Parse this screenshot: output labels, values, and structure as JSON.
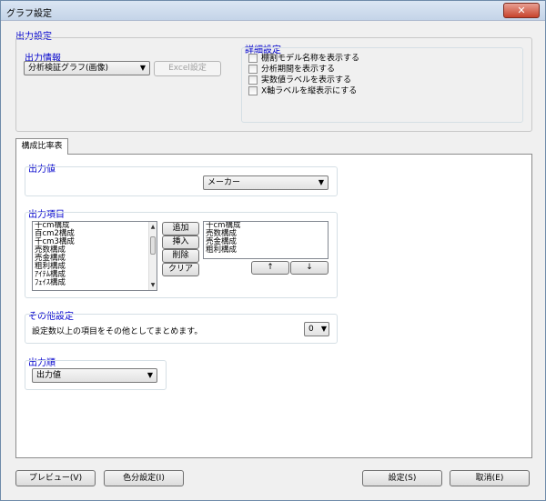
{
  "window": {
    "title": "グラフ設定",
    "close_label": "✕"
  },
  "output_settings": {
    "heading": "出力設定",
    "info": {
      "label": "出力情報",
      "combo_value": "分析検証グラフ(画像)",
      "excel_button": "Excel設定"
    },
    "detail": {
      "label": "詳細設定",
      "checks": [
        {
          "label": "棚割モデル名称を表示する",
          "checked": false
        },
        {
          "label": "分析期間を表示する",
          "checked": false
        },
        {
          "label": "実数値ラベルを表示する",
          "checked": false
        },
        {
          "label": "X軸ラベルを縦表示にする",
          "checked": false
        }
      ]
    }
  },
  "tab": {
    "label": "構成比率表"
  },
  "output_value": {
    "label": "出力値",
    "combo_value": "メーカー"
  },
  "output_items": {
    "label": "出力項目",
    "available": [
      "十cm構成",
      "百cm2構成",
      "千cm3構成",
      "売数構成",
      "売金構成",
      "粗利構成",
      "ｱｲﾃﾑ構成",
      "ﾌｪｲｽ構成"
    ],
    "buttons": {
      "add": "追加",
      "insert": "挿入",
      "delete": "削除",
      "clear": "クリア"
    },
    "selected": [
      "十cm構成",
      "売数構成",
      "売金構成",
      "粗利構成"
    ],
    "up": "↑",
    "down": "↓"
  },
  "other_settings": {
    "label": "その他設定",
    "text": "設定数以上の項目をその他としてまとめます。",
    "combo_value": "0"
  },
  "output_order": {
    "label": "出力順",
    "combo_value": "出力値"
  },
  "footer": {
    "preview": "プレビュー(V)",
    "color": "色分設定(I)",
    "ok": "設定(S)",
    "cancel": "取消(E)"
  }
}
